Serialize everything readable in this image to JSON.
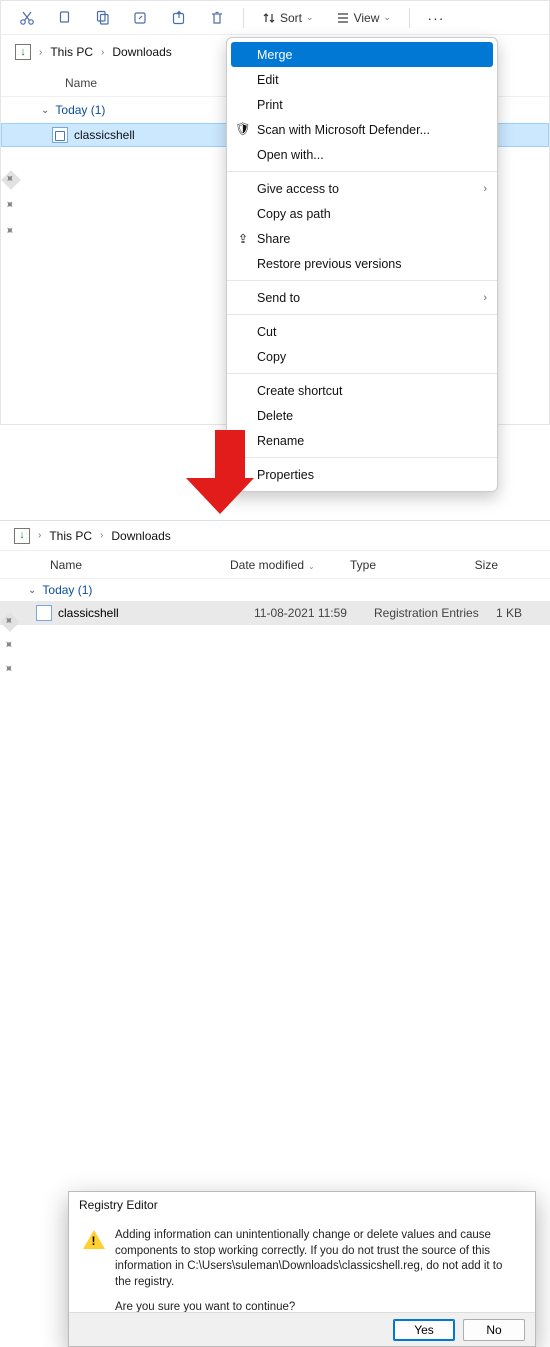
{
  "top": {
    "toolbar": {
      "sort_label": "Sort",
      "view_label": "View"
    },
    "breadcrumb": {
      "pc": "This PC",
      "dl": "Downloads"
    },
    "columns": {
      "name": "Name"
    },
    "group": "Today (1)",
    "file": {
      "name": "classicshell"
    },
    "ctx": {
      "merge": "Merge",
      "edit": "Edit",
      "print": "Print",
      "scan": "Scan with Microsoft Defender...",
      "openwith": "Open with...",
      "giveaccess": "Give access to",
      "copyaspath": "Copy as path",
      "share": "Share",
      "restore": "Restore previous versions",
      "sendto": "Send to",
      "cut": "Cut",
      "copy": "Copy",
      "shortcut": "Create shortcut",
      "delete": "Delete",
      "rename": "Rename",
      "properties": "Properties"
    }
  },
  "bot": {
    "breadcrumb": {
      "pc": "This PC",
      "dl": "Downloads"
    },
    "columns": {
      "name": "Name",
      "date": "Date modified",
      "type": "Type",
      "size": "Size"
    },
    "group": "Today (1)",
    "file": {
      "name": "classicshell",
      "date": "11-08-2021 11:59",
      "type": "Registration Entries",
      "size": "1 KB"
    },
    "dialog": {
      "title": "Registry Editor",
      "msg": "Adding information can unintentionally change or delete values and cause components to stop working correctly. If you do not trust the source of this information in C:\\Users\\suleman\\Downloads\\classicshell.reg, do not add it to the registry.",
      "question": "Are you sure you want to continue?",
      "yes": "Yes",
      "no": "No"
    }
  }
}
